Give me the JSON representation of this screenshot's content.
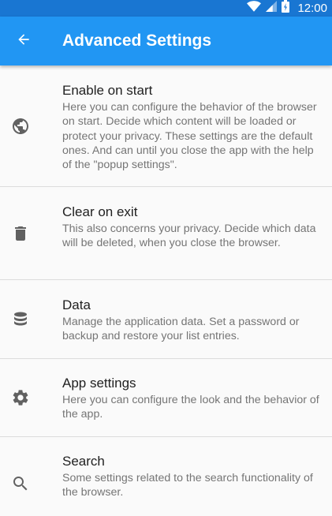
{
  "status_bar": {
    "time": "12:00",
    "icons": [
      "wifi-icon",
      "cell-signal-icon",
      "battery-icon"
    ],
    "background": "#1976d2"
  },
  "app_bar": {
    "title": "Advanced Settings",
    "back_icon": "arrow-back-icon",
    "background": "#2196f3"
  },
  "settings": [
    {
      "icon": "globe-icon",
      "title": "Enable on start",
      "description": "Here you can configure the behavior of the browser on start. Decide which content will be loaded or protect your privacy. These settings are the default ones. And can until you close the app with the help of the \"popup settings\"."
    },
    {
      "icon": "trash-icon",
      "title": "Clear on exit",
      "description": "This also concerns your privacy. Decide which data will be deleted, when you close the browser."
    },
    {
      "icon": "database-icon",
      "title": "Data",
      "description": "Manage the application data. Set a password or backup and restore your list entries."
    },
    {
      "icon": "gear-icon",
      "title": "App settings",
      "description": "Here you can configure the look and the behavior of the app."
    },
    {
      "icon": "search-icon",
      "title": "Search",
      "description": "Some settings related to the search functionality of the browser."
    }
  ]
}
